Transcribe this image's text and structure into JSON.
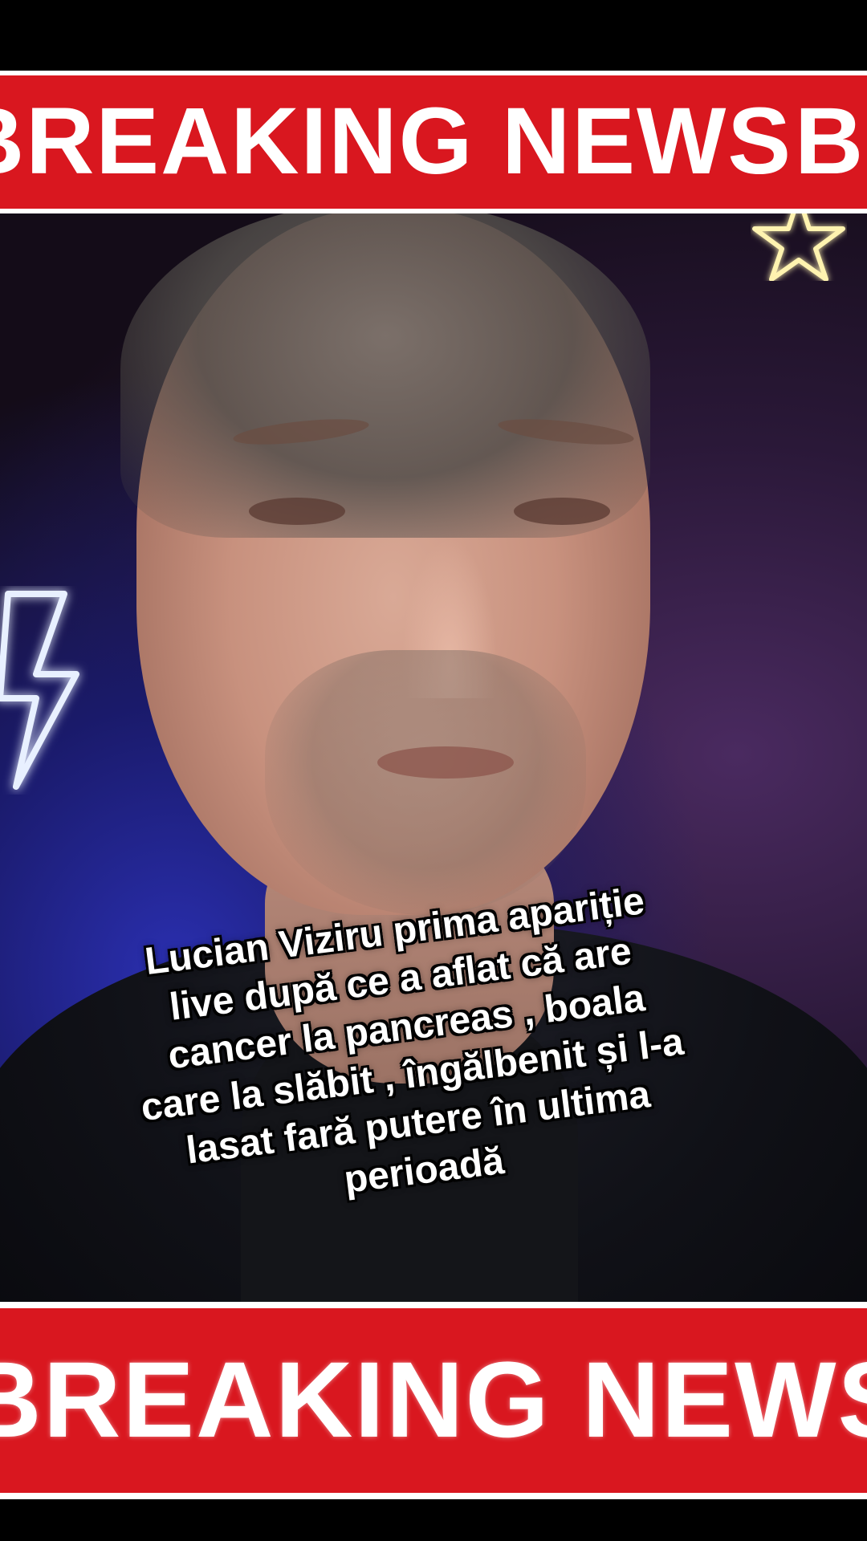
{
  "banners": {
    "top_text": "BREAKING NEWS",
    "top_text_repeat": "B",
    "bottom_text": "BREAKING NEWS",
    "color": "#d9171f"
  },
  "caption": {
    "lines": [
      "Lucian Viziru prima apariție",
      "live după ce a aflat că are",
      "cancer la pancreas , boala",
      "care la slăbit , îngălbenit și l-a",
      "lasat fară putere în ultima",
      "perioadă"
    ]
  },
  "decorations": {
    "left_neon_icon": "lightning-bolt-icon",
    "right_neon_icon": "star-icon",
    "neon_bolt_color": "#e8f0ff",
    "neon_star_color": "#fff3b0"
  }
}
